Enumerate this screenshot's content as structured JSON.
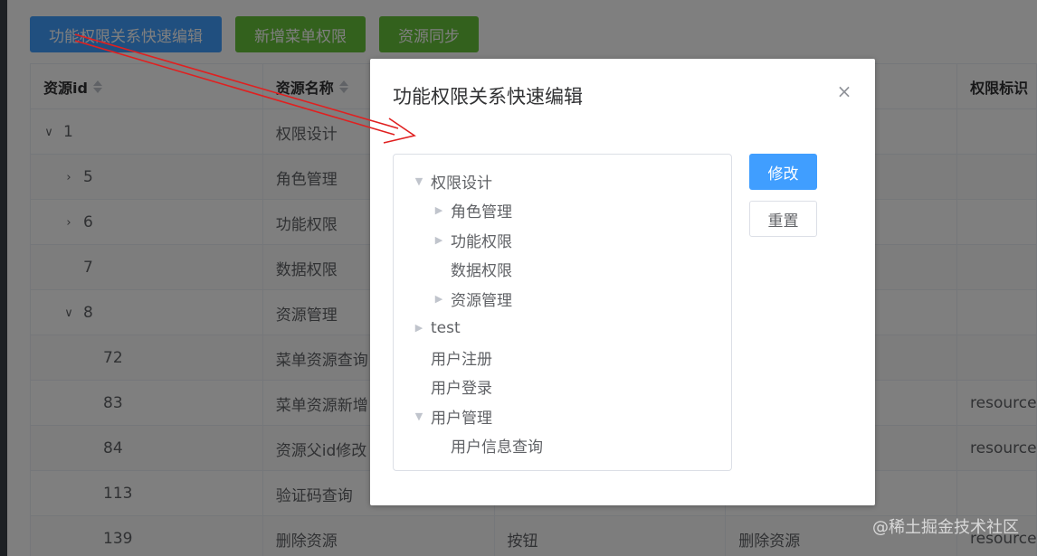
{
  "toolbar": {
    "quick_edit_label": "功能权限关系快速编辑",
    "add_menu_label": "新增菜单权限",
    "sync_label": "资源同步"
  },
  "table": {
    "headers": [
      "资源id",
      "资源名称",
      "",
      "",
      "权限标识"
    ],
    "rows": [
      {
        "id": "1",
        "name": "权限设计",
        "type": "",
        "desc": "",
        "perm": "",
        "expand": "∨"
      },
      {
        "id": "5",
        "name": "角色管理",
        "type": "",
        "desc": "",
        "perm": "",
        "expand": "›"
      },
      {
        "id": "6",
        "name": "功能权限",
        "type": "",
        "desc": "",
        "perm": "",
        "expand": "›"
      },
      {
        "id": "7",
        "name": "数据权限",
        "type": "",
        "desc": "",
        "perm": "",
        "expand": ""
      },
      {
        "id": "8",
        "name": "资源管理",
        "type": "",
        "desc": "",
        "perm": "",
        "expand": "∨"
      },
      {
        "id": "72",
        "name": "菜单资源查询",
        "type": "",
        "desc": "",
        "perm": "",
        "expand": ""
      },
      {
        "id": "83",
        "name": "菜单资源新增",
        "type": "",
        "desc": "",
        "perm": "resource:",
        "expand": ""
      },
      {
        "id": "84",
        "name": "资源父id修改",
        "type": "",
        "desc": "",
        "perm": "resource:",
        "expand": ""
      },
      {
        "id": "113",
        "name": "验证码查询",
        "type": "",
        "desc": "",
        "perm": "",
        "expand": ""
      },
      {
        "id": "139",
        "name": "删除资源",
        "type": "按钮",
        "desc": "删除资源",
        "perm": "resource:",
        "expand": ""
      }
    ]
  },
  "dialog": {
    "title": "功能权限关系快速编辑",
    "close_icon": "×",
    "edit_label": "修改",
    "reset_label": "重置",
    "tree": [
      {
        "label": "权限设计",
        "level": 0,
        "caret": "▼"
      },
      {
        "label": "角色管理",
        "level": 1,
        "caret": "▶"
      },
      {
        "label": "功能权限",
        "level": 1,
        "caret": "▶"
      },
      {
        "label": "数据权限",
        "level": 1,
        "caret": ""
      },
      {
        "label": "资源管理",
        "level": 1,
        "caret": "▶"
      },
      {
        "label": "test",
        "level": 0,
        "caret": "▶"
      },
      {
        "label": "用户注册",
        "level": 0,
        "caret": ""
      },
      {
        "label": "用户登录",
        "level": 0,
        "caret": ""
      },
      {
        "label": "用户管理",
        "level": 0,
        "caret": "▼"
      },
      {
        "label": "用户信息查询",
        "level": 1,
        "caret": ""
      }
    ]
  },
  "watermark": "@稀土掘金技术社区",
  "colors": {
    "primary": "#409eff",
    "success": "#67c23a",
    "annotation_arrow": "#e02020"
  }
}
